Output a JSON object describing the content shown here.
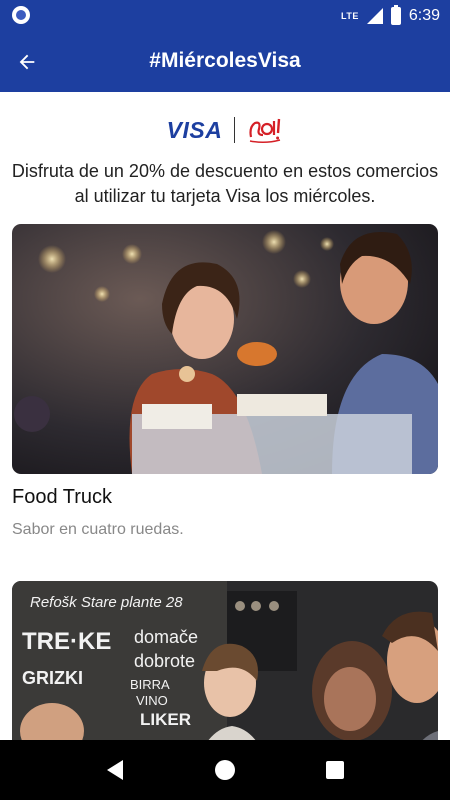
{
  "status": {
    "network": "LTE",
    "time": "6:39"
  },
  "app_bar": {
    "title": "#MiércolesVisa",
    "back_icon": "arrow-left-icon"
  },
  "brand": {
    "visa": "VISA",
    "partner_mark": "Sol!",
    "visa_color": "#1d3fa0",
    "partner_color": "#d52027"
  },
  "intro": {
    "line1": "Disfruta de un 20% de descuento en estos comercios",
    "line2": "al utilizar tu tarjeta Visa los miércoles."
  },
  "cards": [
    {
      "title": "Food Truck",
      "subtitle": "Sabor en cuatro ruedas."
    },
    {
      "title": "",
      "subtitle": "",
      "chalkboard": [
        "Refošk Stare plante 28",
        "TRE·KE",
        "GRIZKI",
        "domače",
        "dobrote",
        "BIRRA",
        "VINO",
        "LIKER"
      ]
    }
  ],
  "colors": {
    "primary": "#1d3fa0",
    "text": "#222222",
    "muted": "#888888"
  },
  "nav": [
    "back-triangle-icon",
    "home-circle-icon",
    "recents-square-icon"
  ]
}
